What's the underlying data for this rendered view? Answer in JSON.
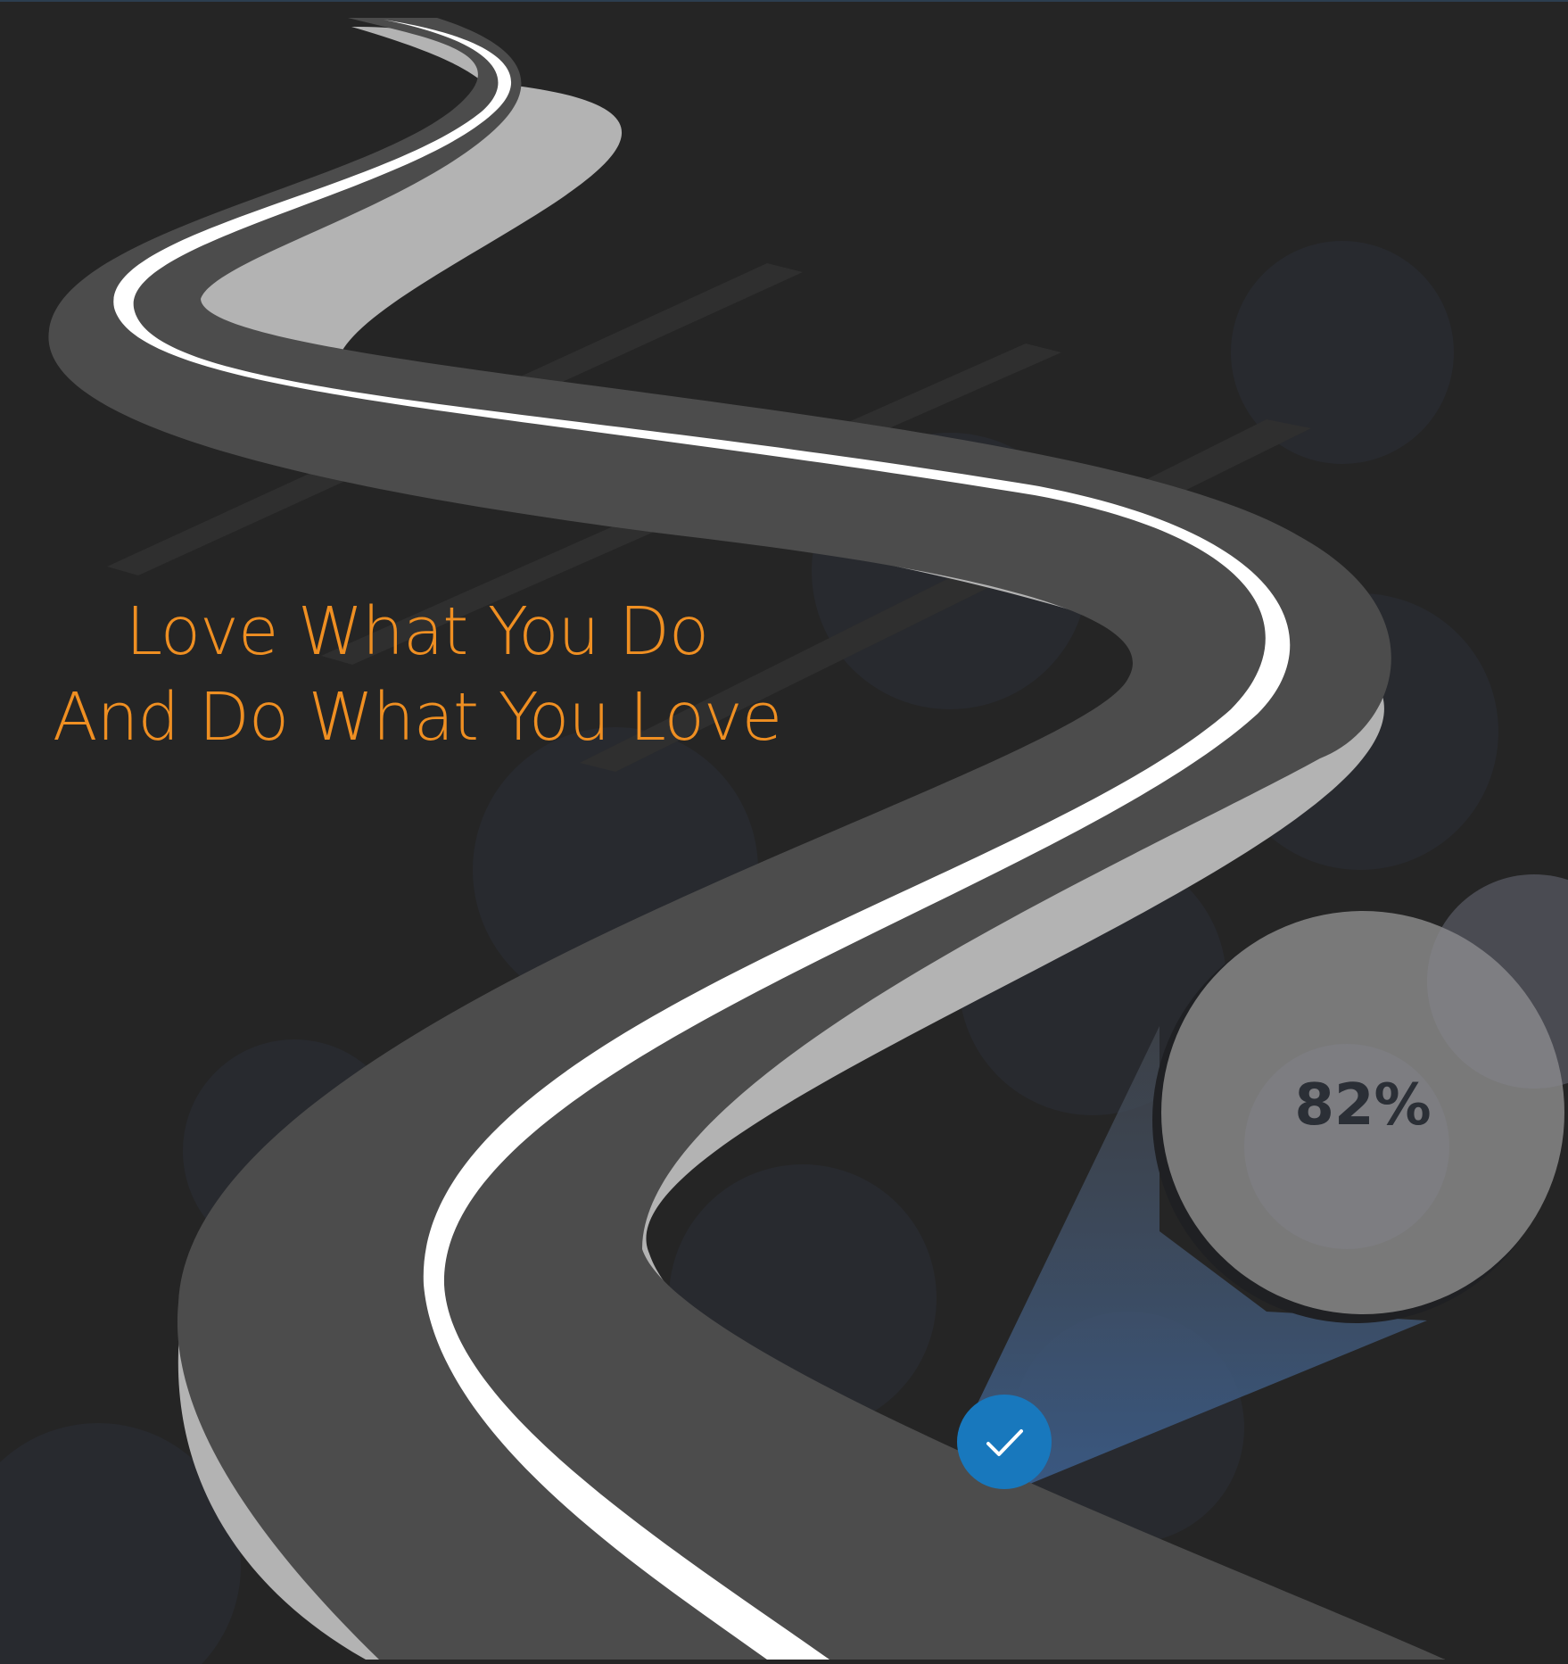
{
  "poster": {
    "headline_line1": "Love What You Do",
    "headline_line2": "And Do What You Love",
    "progress_label": "82%",
    "progress_value": 0.82,
    "badge_icon": "check-icon"
  },
  "colors": {
    "background": "#252525",
    "headline": "#ef8f22",
    "road_surface": "#4c4c4c",
    "road_edge": "#b3b3b3",
    "lane_marking": "#ffffff",
    "bubble": "#7a7a7a",
    "badge": "#1878bd",
    "beam": "#3a5a85"
  }
}
